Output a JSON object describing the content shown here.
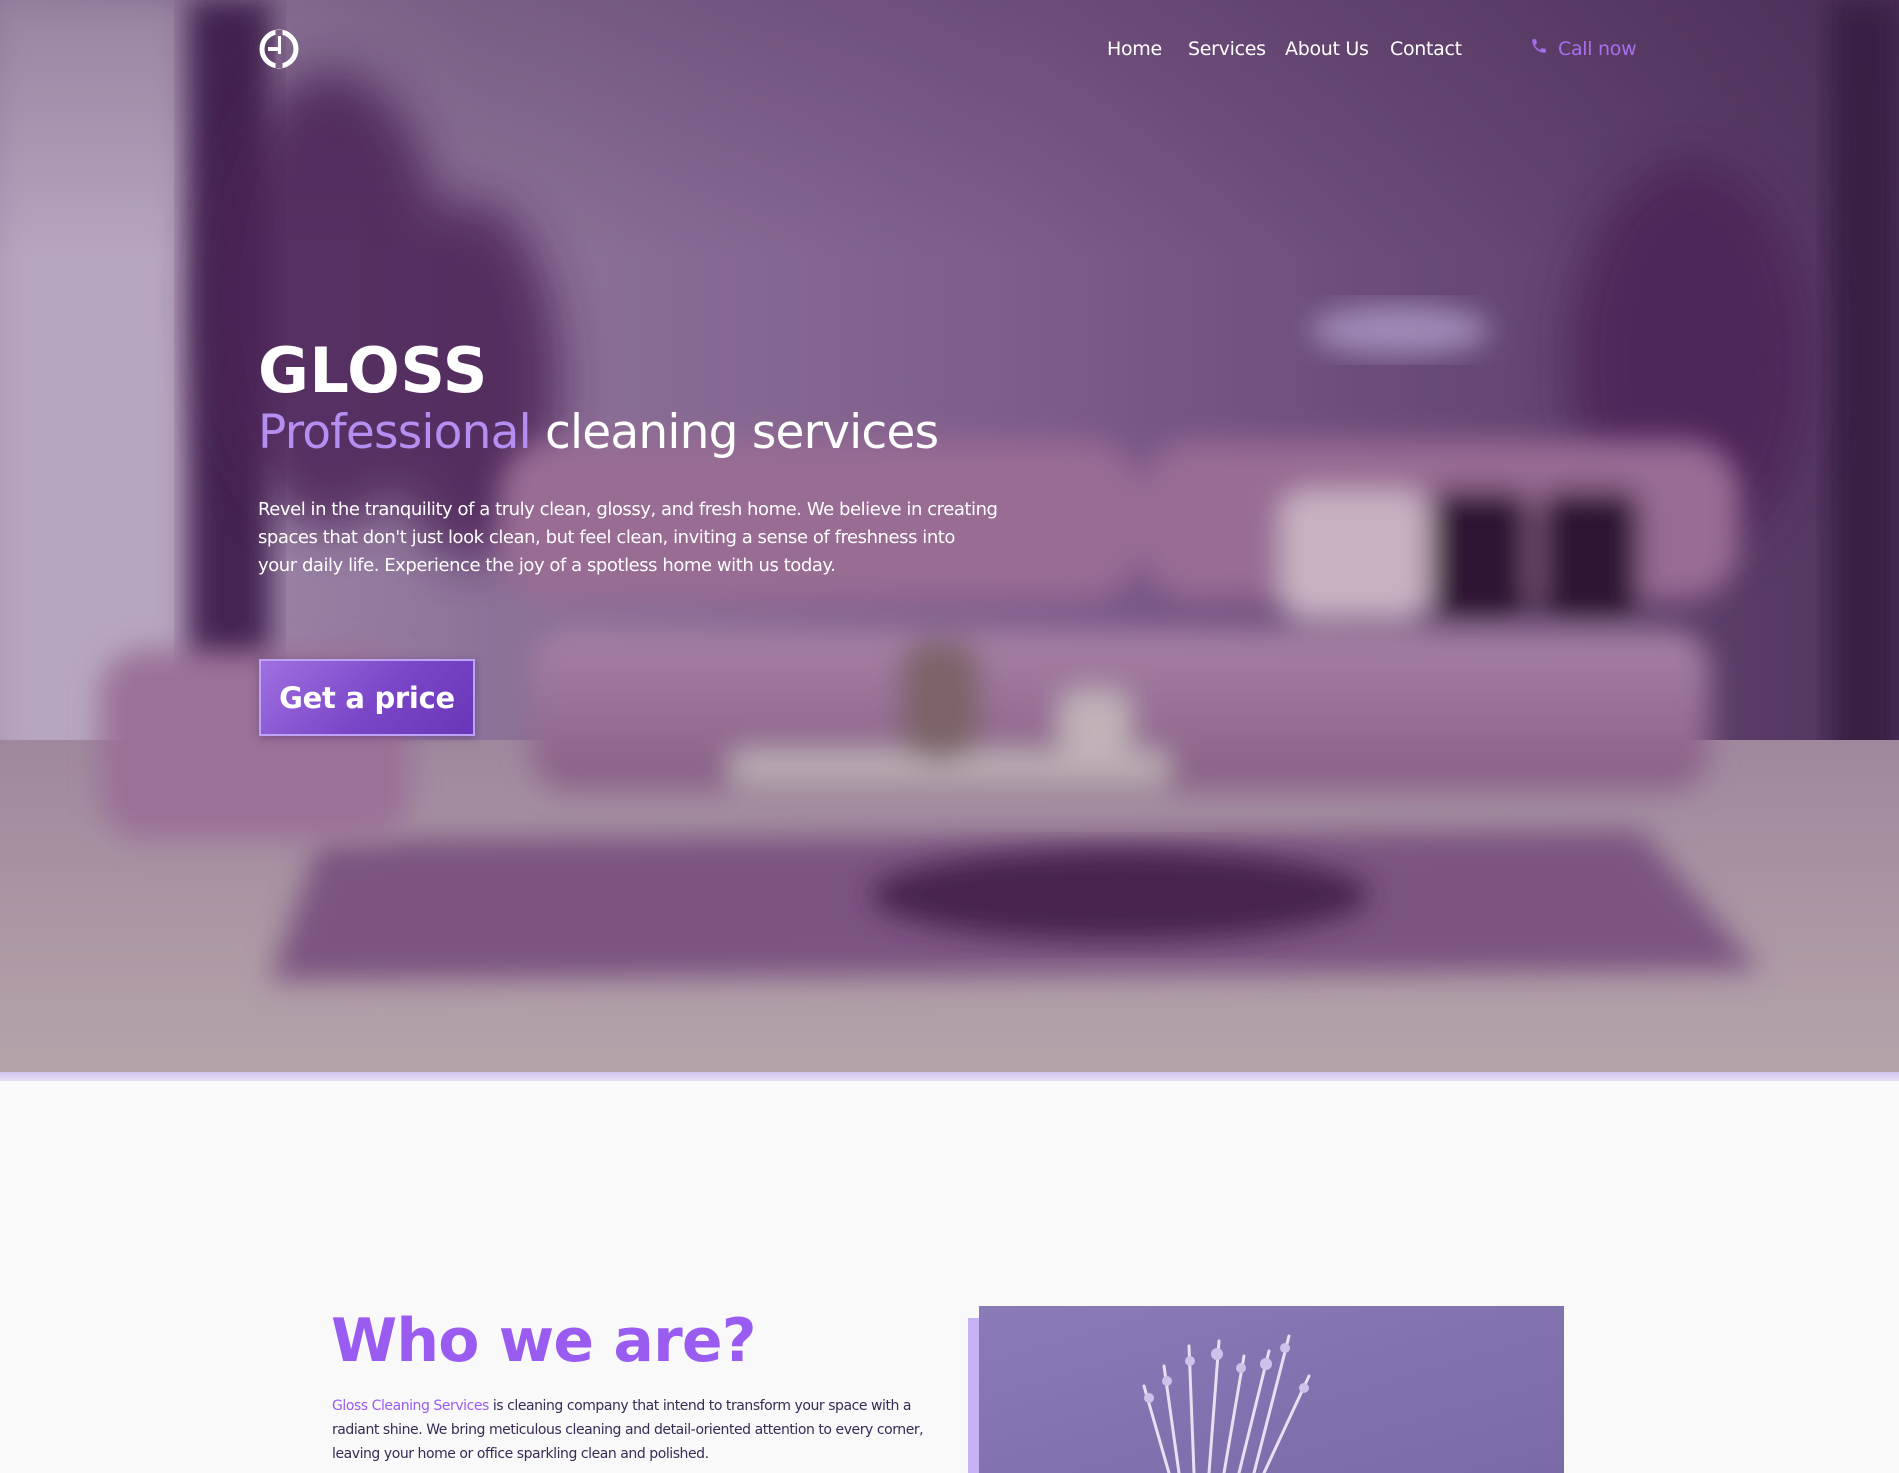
{
  "nav": {
    "links": [
      {
        "label": "Home"
      },
      {
        "label": "Services"
      },
      {
        "label": "About Us"
      },
      {
        "label": "Contact"
      }
    ],
    "call_label": "Call now",
    "icons": {
      "logo": "gloss-logo-icon",
      "phone": "phone-icon"
    }
  },
  "hero": {
    "title": "GLOSS",
    "subtitle_accent": "Professional",
    "subtitle_rest": " cleaning services",
    "description": "Revel in the tranquility of a truly clean, glossy, and fresh home. We believe in creating spaces that don't just look clean, but feel clean, inviting a sense of freshness into your daily life. Experience the joy of a spotless home with us today.",
    "cta_label": "Get a price"
  },
  "about": {
    "title": "Who we are?",
    "brand_name": "Gloss Cleaning Services",
    "text": " is cleaning company that intend to transform your space with a radiant shine. We bring meticulous cleaning and detail-oriented attention to every corner, leaving your home or office sparkling clean and polished."
  },
  "colors": {
    "accent": "#9a5cf0",
    "accent_light": "#b48ef0",
    "call": "#a86ef0",
    "button_border": "#bca3f5",
    "underline": "#d2c3ef"
  }
}
